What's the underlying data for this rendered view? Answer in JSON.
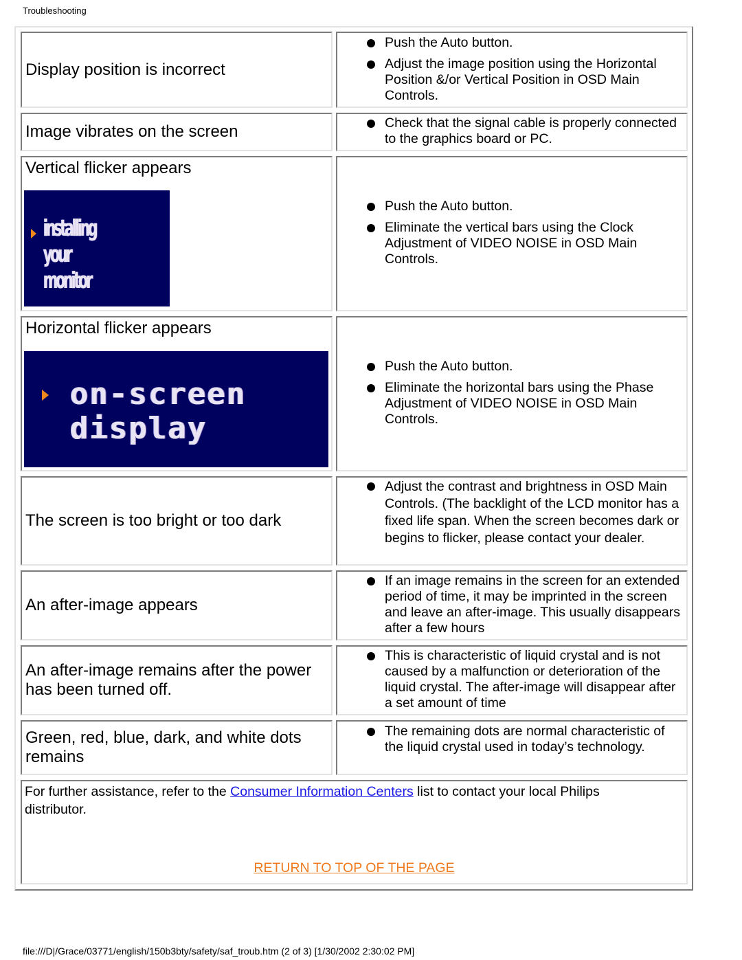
{
  "header": {
    "title": "Troubleshooting"
  },
  "rows": [
    {
      "problem": "Display position is incorrect",
      "solutions": [
        "Push the Auto button.",
        "Adjust the image position using the Horizontal Position &/or Vertical Position in OSD Main Controls."
      ]
    },
    {
      "problem": "Image vibrates on the screen",
      "solutions": [
        "Check that the signal cable is properly connected to the graphics board or PC."
      ]
    },
    {
      "problem": "Vertical flicker appears",
      "image": {
        "label_line1": "installing your",
        "label_line2": "monitor",
        "alt": "installing your monitor"
      },
      "solutions": [
        "Push the Auto button.",
        "Eliminate the vertical bars using the Clock Adjustment of VIDEO NOISE in OSD Main Controls."
      ]
    },
    {
      "problem": "Horizontal flicker appears",
      "image": {
        "label_line1": "on-screen",
        "label_line2": "display",
        "alt": "on-screen display"
      },
      "solutions": [
        "Push the Auto button.",
        "Eliminate the horizontal bars using the Phase Adjustment of VIDEO NOISE in OSD Main Controls."
      ]
    },
    {
      "problem": "The screen is too bright or too dark",
      "solutions": [
        "Adjust the contrast and brightness in OSD Main Controls. (The backlight of the LCD monitor has a fixed life span. When the screen becomes dark or begins to flicker, please contact your dealer."
      ]
    },
    {
      "problem": "An after-image appears",
      "solutions": [
        "If an image remains in the screen for an extended period of time, it may be imprinted in the screen and leave an after-image. This usually disappears after a few hours"
      ]
    },
    {
      "problem": "An after-image remains after the power has been turned off.",
      "solutions": [
        "This is characteristic of liquid crystal and is not caused by a malfunction or deterioration of the liquid crystal. The after-image will disappear after a set amount of time"
      ]
    },
    {
      "problem": "Green, red, blue, dark, and white dots remains",
      "solutions": [
        "The remaining dots are normal characteristic of the liquid crystal used in today’s technology."
      ]
    }
  ],
  "further": {
    "text_before": "For further assistance, refer to the ",
    "link_label": "Consumer Information Centers",
    "text_after": " list to contact your local Philips distributor."
  },
  "return_link": {
    "label": "RETURN TO TOP OF THE PAGE"
  },
  "colors": {
    "link": "#1a1ae6",
    "return_link": "#f07a1e",
    "osd_background": "#00005f",
    "osd_arrow": "#f08a1c"
  },
  "footer": {
    "path": "file:///D|/Grace/03771/english/150b3bty/safety/saf_troub.htm (2 of 3) [1/30/2002 2:30:02 PM]"
  }
}
